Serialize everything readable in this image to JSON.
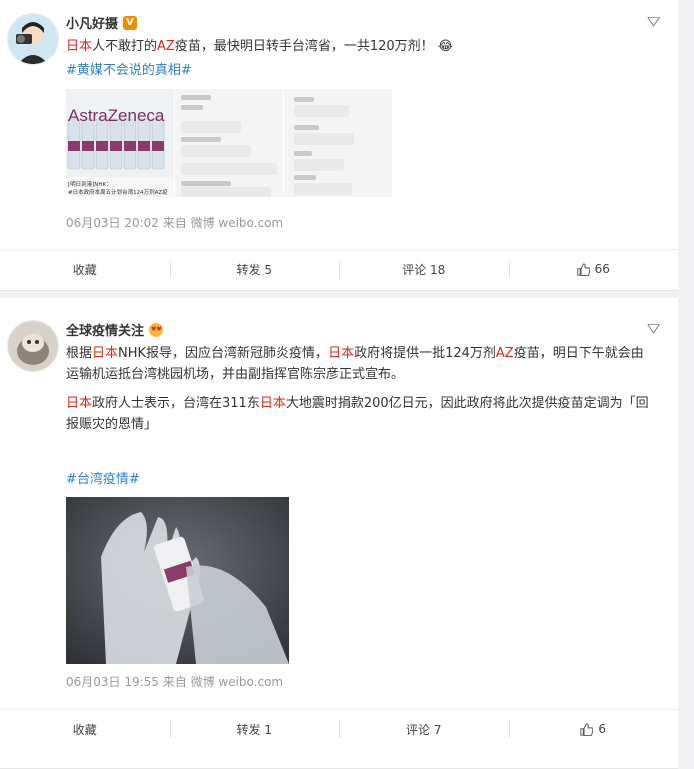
{
  "posts": [
    {
      "user": "小凡好摄",
      "verified": "V",
      "text": [
        {
          "t": "日本",
          "red": true
        },
        {
          "t": "人不敢打的",
          "red": false
        },
        {
          "t": "AZ",
          "red": true
        },
        {
          "t": "疫苗，最快明日转手台湾省，一共120万剂！",
          "red": false
        }
      ],
      "emoji_face": "😂",
      "hashtag": "#黄媒不会说的真相#",
      "images": {
        "brand": "AstraZeneca",
        "caption_left": "[明日到港]NHK：",
        "caption_right": "#日本政府本周五计划台湾124万剂AZ疫"
      },
      "meta": "06月03日 20:02  来自 微博 weibo.com",
      "actions": {
        "collect": "收藏",
        "repost": "转发 5",
        "comment": "评论 18",
        "like": "66"
      }
    },
    {
      "user": "全球疫情关注",
      "verified": "",
      "para1": [
        {
          "t": "根据",
          "red": false
        },
        {
          "t": "日本",
          "red": true
        },
        {
          "t": "NHK报导，因应台湾新冠肺炎疫情，",
          "red": false
        },
        {
          "t": "日本",
          "red": true
        },
        {
          "t": "政府将提供一批124万剂",
          "red": false
        },
        {
          "t": "AZ",
          "red": true
        },
        {
          "t": "疫苗，明日下午就会由运输机运抵台湾桃园机场，并由副指挥官陈宗彦正式宣布。",
          "red": false
        }
      ],
      "para2": [
        {
          "t": "日本",
          "red": true
        },
        {
          "t": "政府人士表示，台湾在311东",
          "red": false
        },
        {
          "t": "日本",
          "red": true
        },
        {
          "t": "大地震时捐款200亿日元，因此政府将此次提供疫苗定调为「回报赈灾的恩情」",
          "red": false
        }
      ],
      "hashtag": "#台湾疫情#",
      "meta": "06月03日 19:55  来自 微博 weibo.com",
      "actions": {
        "collect": "收藏",
        "repost": "转发 1",
        "comment": "评论 7",
        "like": "6"
      }
    }
  ],
  "icons": [
    "chevron-down-icon",
    "thumb-up-icon",
    "verified-badge-icon",
    "laughing-emoji-icon",
    "heart-eyes-emoji-icon"
  ],
  "colors": {
    "keyword": "#e0271a",
    "hashtag": "#2e7fd0",
    "meta": "#999999",
    "background": "#f2f2f5"
  }
}
